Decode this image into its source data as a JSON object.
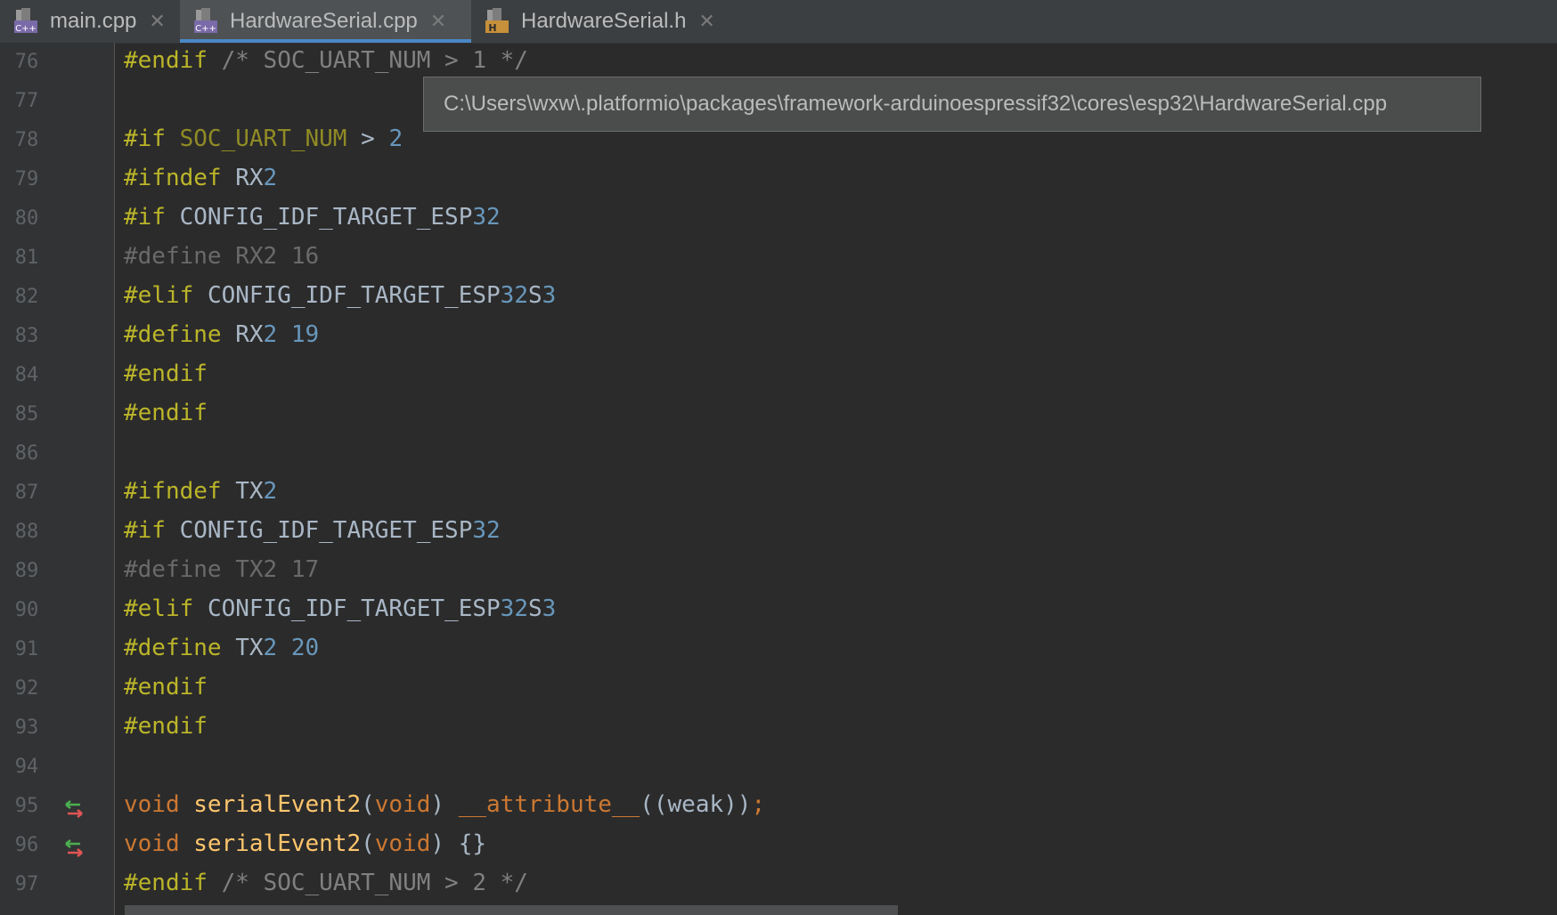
{
  "tabs": [
    {
      "label": "main.cpp",
      "icon": "cpp-file-icon",
      "active": false
    },
    {
      "label": "HardwareSerial.cpp",
      "icon": "cpp-file-icon",
      "active": true
    },
    {
      "label": "HardwareSerial.h",
      "icon": "header-file-icon",
      "active": false
    }
  ],
  "tooltip": {
    "path": "C:\\Users\\wxw\\.platformio\\packages\\framework-arduinoespressif32\\cores\\esp32\\HardwareSerial.cpp"
  },
  "lines": [
    {
      "n": "76",
      "code": "#endif /* SOC_UART_NUM > 1 */"
    },
    {
      "n": "77",
      "code": ""
    },
    {
      "n": "78",
      "code": "#if SOC_UART_NUM > 2"
    },
    {
      "n": "79",
      "code": "#ifndef RX2"
    },
    {
      "n": "80",
      "code": "#if CONFIG_IDF_TARGET_ESP32"
    },
    {
      "n": "81",
      "code": "#define RX2 16"
    },
    {
      "n": "82",
      "code": "#elif CONFIG_IDF_TARGET_ESP32S3"
    },
    {
      "n": "83",
      "code": "#define RX2 19"
    },
    {
      "n": "84",
      "code": "#endif"
    },
    {
      "n": "85",
      "code": "#endif"
    },
    {
      "n": "86",
      "code": ""
    },
    {
      "n": "87",
      "code": "#ifndef TX2"
    },
    {
      "n": "88",
      "code": "#if CONFIG_IDF_TARGET_ESP32"
    },
    {
      "n": "89",
      "code": "#define TX2 17"
    },
    {
      "n": "90",
      "code": "#elif CONFIG_IDF_TARGET_ESP32S3"
    },
    {
      "n": "91",
      "code": "#define TX2 20"
    },
    {
      "n": "92",
      "code": "#endif"
    },
    {
      "n": "93",
      "code": "#endif"
    },
    {
      "n": "94",
      "code": ""
    },
    {
      "n": "95",
      "code": "void serialEvent2(void) __attribute__((weak));"
    },
    {
      "n": "96",
      "code": "void serialEvent2(void) {}"
    },
    {
      "n": "97",
      "code": "#endif /* SOC_UART_NUM > 2 */"
    }
  ],
  "markers": {
    "95": "navigate-declaration-icon",
    "96": "navigate-definition-icon"
  }
}
